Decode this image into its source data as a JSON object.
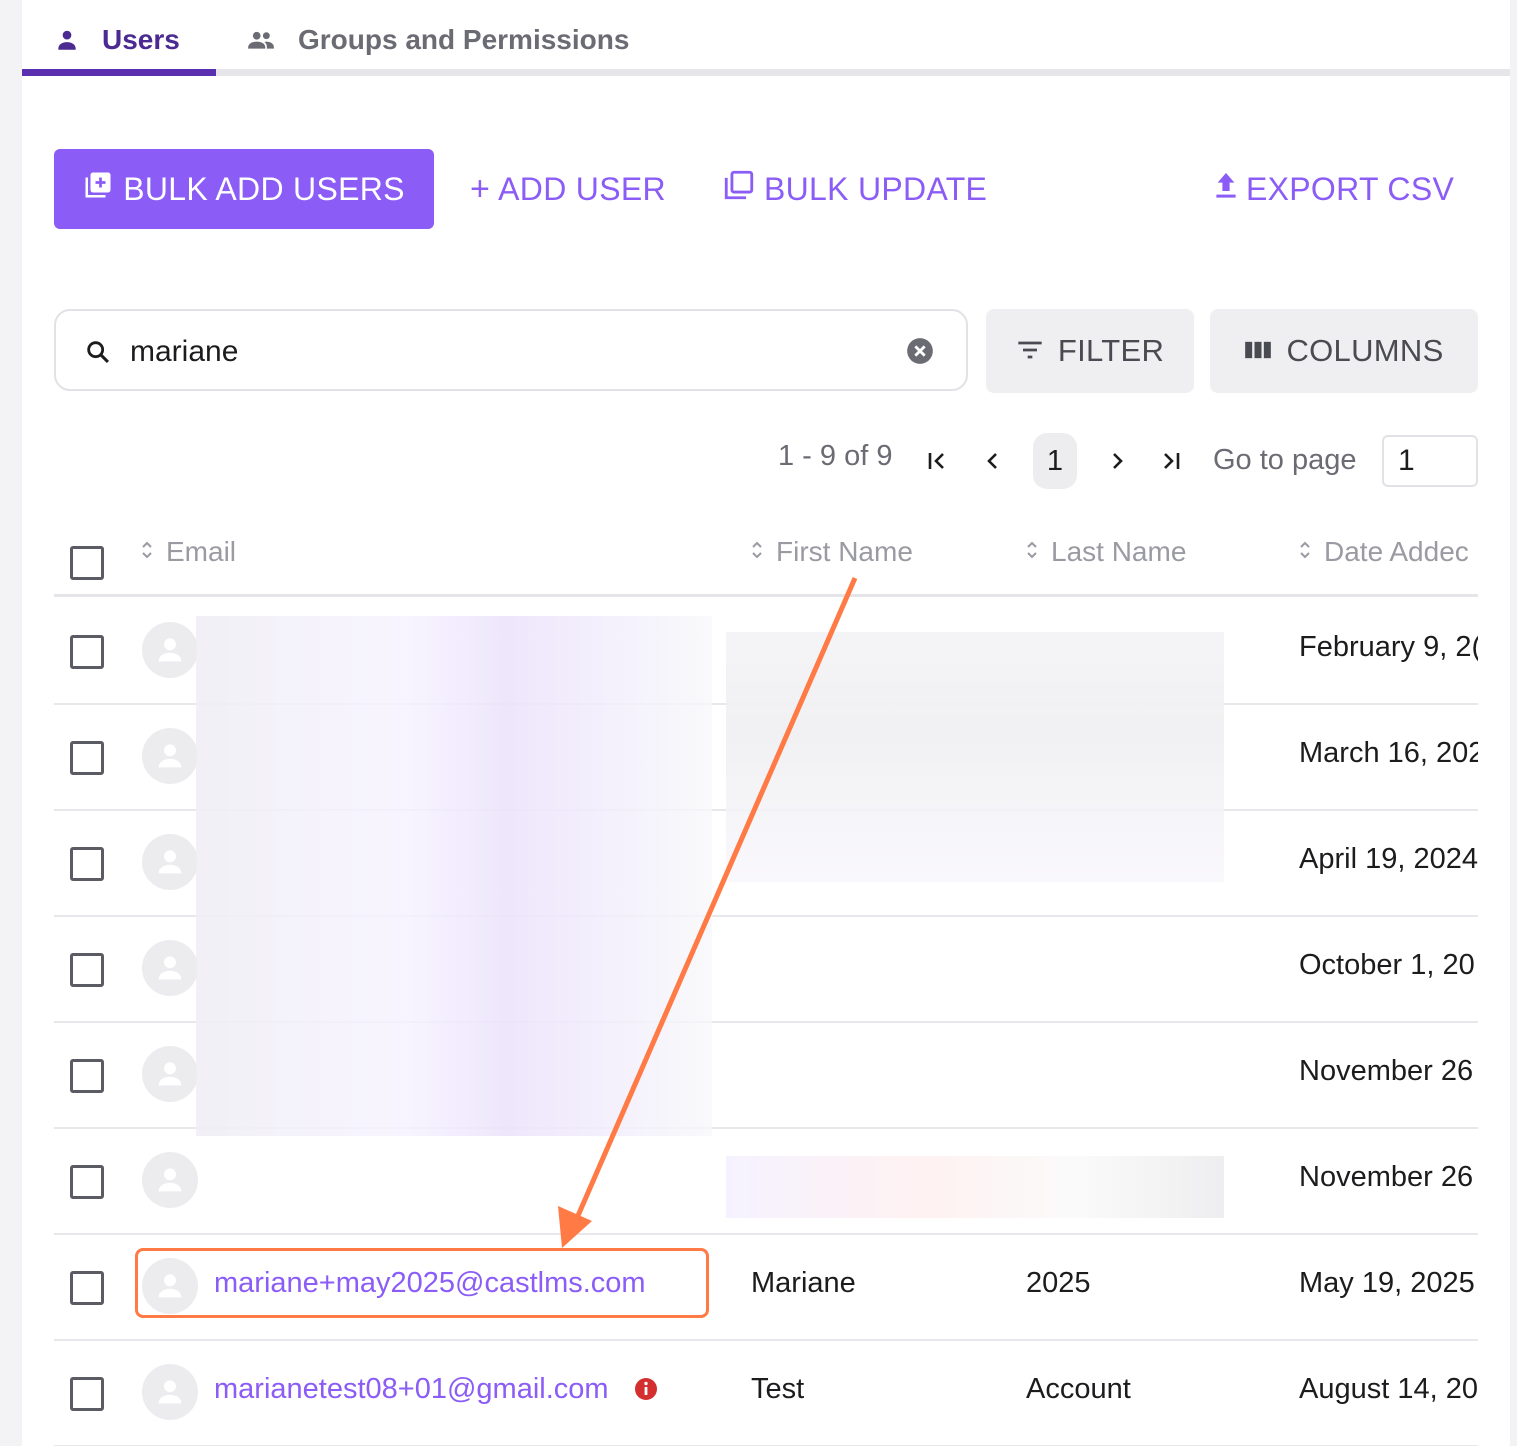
{
  "tabs": [
    {
      "label": "Users",
      "icon": "person-icon",
      "active": true
    },
    {
      "label": "Groups and Permissions",
      "icon": "people-icon",
      "active": false
    }
  ],
  "toolbar": {
    "bulk_add": "BULK ADD USERS",
    "add_user": "ADD USER",
    "bulk_update": "BULK UPDATE",
    "export_csv": "EXPORT CSV"
  },
  "search": {
    "value": "mariane",
    "placeholder": ""
  },
  "filter_label": "FILTER",
  "columns_label": "COLUMNS",
  "pagination": {
    "range": "1 - 9 of 9",
    "current_page": "1",
    "goto_label": "Go to page",
    "goto_value": "1"
  },
  "table": {
    "headers": {
      "email": "Email",
      "first_name": "First Name",
      "last_name": "Last Name",
      "date_added": "Date Addec"
    },
    "rows": [
      {
        "email": "",
        "first": "",
        "last": "",
        "date": "February 9, 2("
      },
      {
        "email": "",
        "first": "",
        "last": "",
        "date": "March 16, 202"
      },
      {
        "email": "",
        "first": "",
        "last": "",
        "date": "April 19, 2024"
      },
      {
        "email": "",
        "first": "",
        "last": "",
        "date": "October 1, 20"
      },
      {
        "email": "",
        "first": "",
        "last": "",
        "date": "November 26"
      },
      {
        "email": "",
        "first": "",
        "last": "",
        "date": "November 26"
      },
      {
        "email": "mariane+may2025@castlms.com",
        "first": "Mariane",
        "last": "2025",
        "date": "May 19, 2025"
      },
      {
        "email": "marianetest08+01@gmail.com",
        "first": "Test",
        "last": "Account",
        "date": "August 14, 20"
      }
    ]
  },
  "colors": {
    "accent": "#8b5cf6",
    "tab_active": "#5a2fb0",
    "annotation": "#ff7a45",
    "warning": "#d32f2f"
  }
}
